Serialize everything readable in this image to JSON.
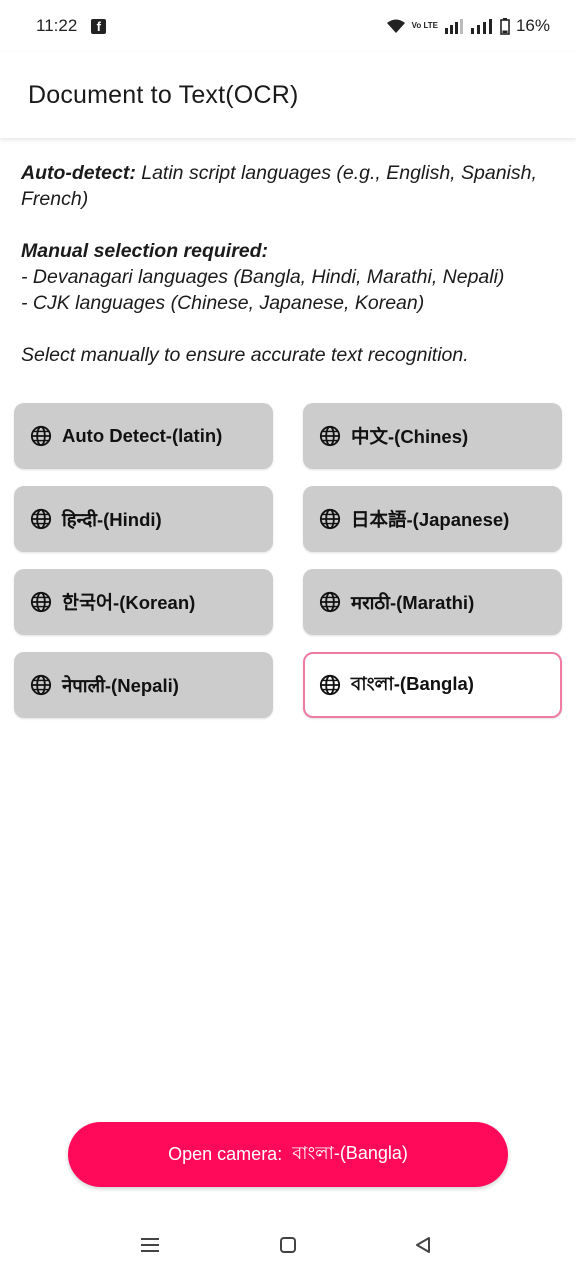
{
  "status_bar": {
    "time": "11:22",
    "notification_icon": "facebook-icon",
    "volte_text": "Vo LTE",
    "battery_text": "16%"
  },
  "app_bar": {
    "title": "Document to Text(OCR)"
  },
  "info": {
    "auto_label": "Auto-detect:",
    "auto_text": " Latin script languages (e.g., English, Spanish, French)",
    "manual_label": "Manual selection required:",
    "manual_line1": "- Devanagari languages (Bangla, Hindi, Marathi, Nepali)",
    "manual_line2": "- CJK languages (Chinese, Japanese, Korean)",
    "footer": "Select manually to ensure accurate text recognition."
  },
  "languages": [
    {
      "label": "Auto Detect-(latin)",
      "icon": "globe-icon",
      "selected": false
    },
    {
      "label": "中文-(Chines)",
      "icon": "globe-icon",
      "selected": false
    },
    {
      "label": "हिन्दी-(Hindi)",
      "icon": "globe-icon",
      "selected": false
    },
    {
      "label": "日本語-(Japanese)",
      "icon": "globe-icon",
      "selected": false
    },
    {
      "label": "한국어-(Korean)",
      "icon": "globe-icon",
      "selected": false
    },
    {
      "label": "मराठी-(Marathi)",
      "icon": "globe-icon",
      "selected": false
    },
    {
      "label": "नेपाली-(Nepali)",
      "icon": "globe-icon",
      "selected": false
    },
    {
      "label": "বাংলা-(Bangla)",
      "icon": "globe-icon",
      "selected": true
    }
  ],
  "camera_button": {
    "prefix": "Open camera:  ",
    "language": "বাংলা-(Bangla)"
  },
  "colors": {
    "accent": "#ff0a5a",
    "selected_border": "#f07aa3",
    "button_bg": "#cccccc"
  },
  "nav_bar": {
    "items": [
      "menu-icon",
      "home-icon",
      "back-icon"
    ]
  }
}
